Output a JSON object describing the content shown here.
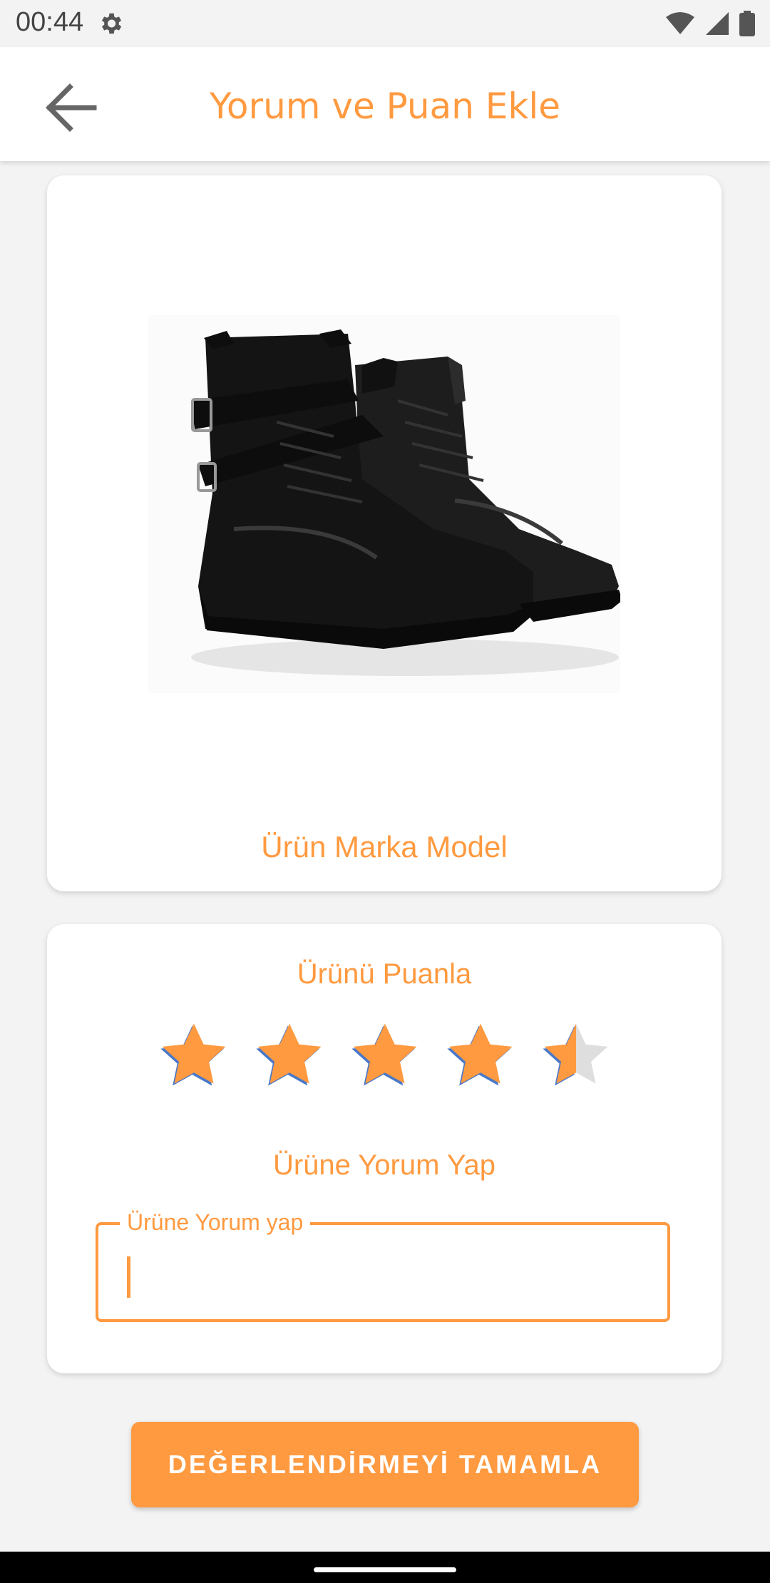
{
  "status": {
    "time": "00:44",
    "icons": [
      "gear-icon",
      "wifi-icon",
      "signal-icon",
      "battery-icon"
    ]
  },
  "appbar": {
    "title": "Yorum ve Puan Ekle",
    "back_icon": "arrow-left-icon"
  },
  "product": {
    "image": "black-leather-boots",
    "name": "Ürün Marka Model"
  },
  "rating": {
    "label": "Ürünü Puanla",
    "value": 4.5,
    "max": 5
  },
  "comment": {
    "label": "Ürüne Yorum Yap",
    "field_label": "Ürüne Yorum yap",
    "value": ""
  },
  "actions": {
    "submit_label": "DEĞERLENDİRMEYİ TAMAMLA"
  },
  "colors": {
    "accent": "#ff9a40",
    "star_empty": "#dedede",
    "star_shadow": "#4a78c8"
  }
}
